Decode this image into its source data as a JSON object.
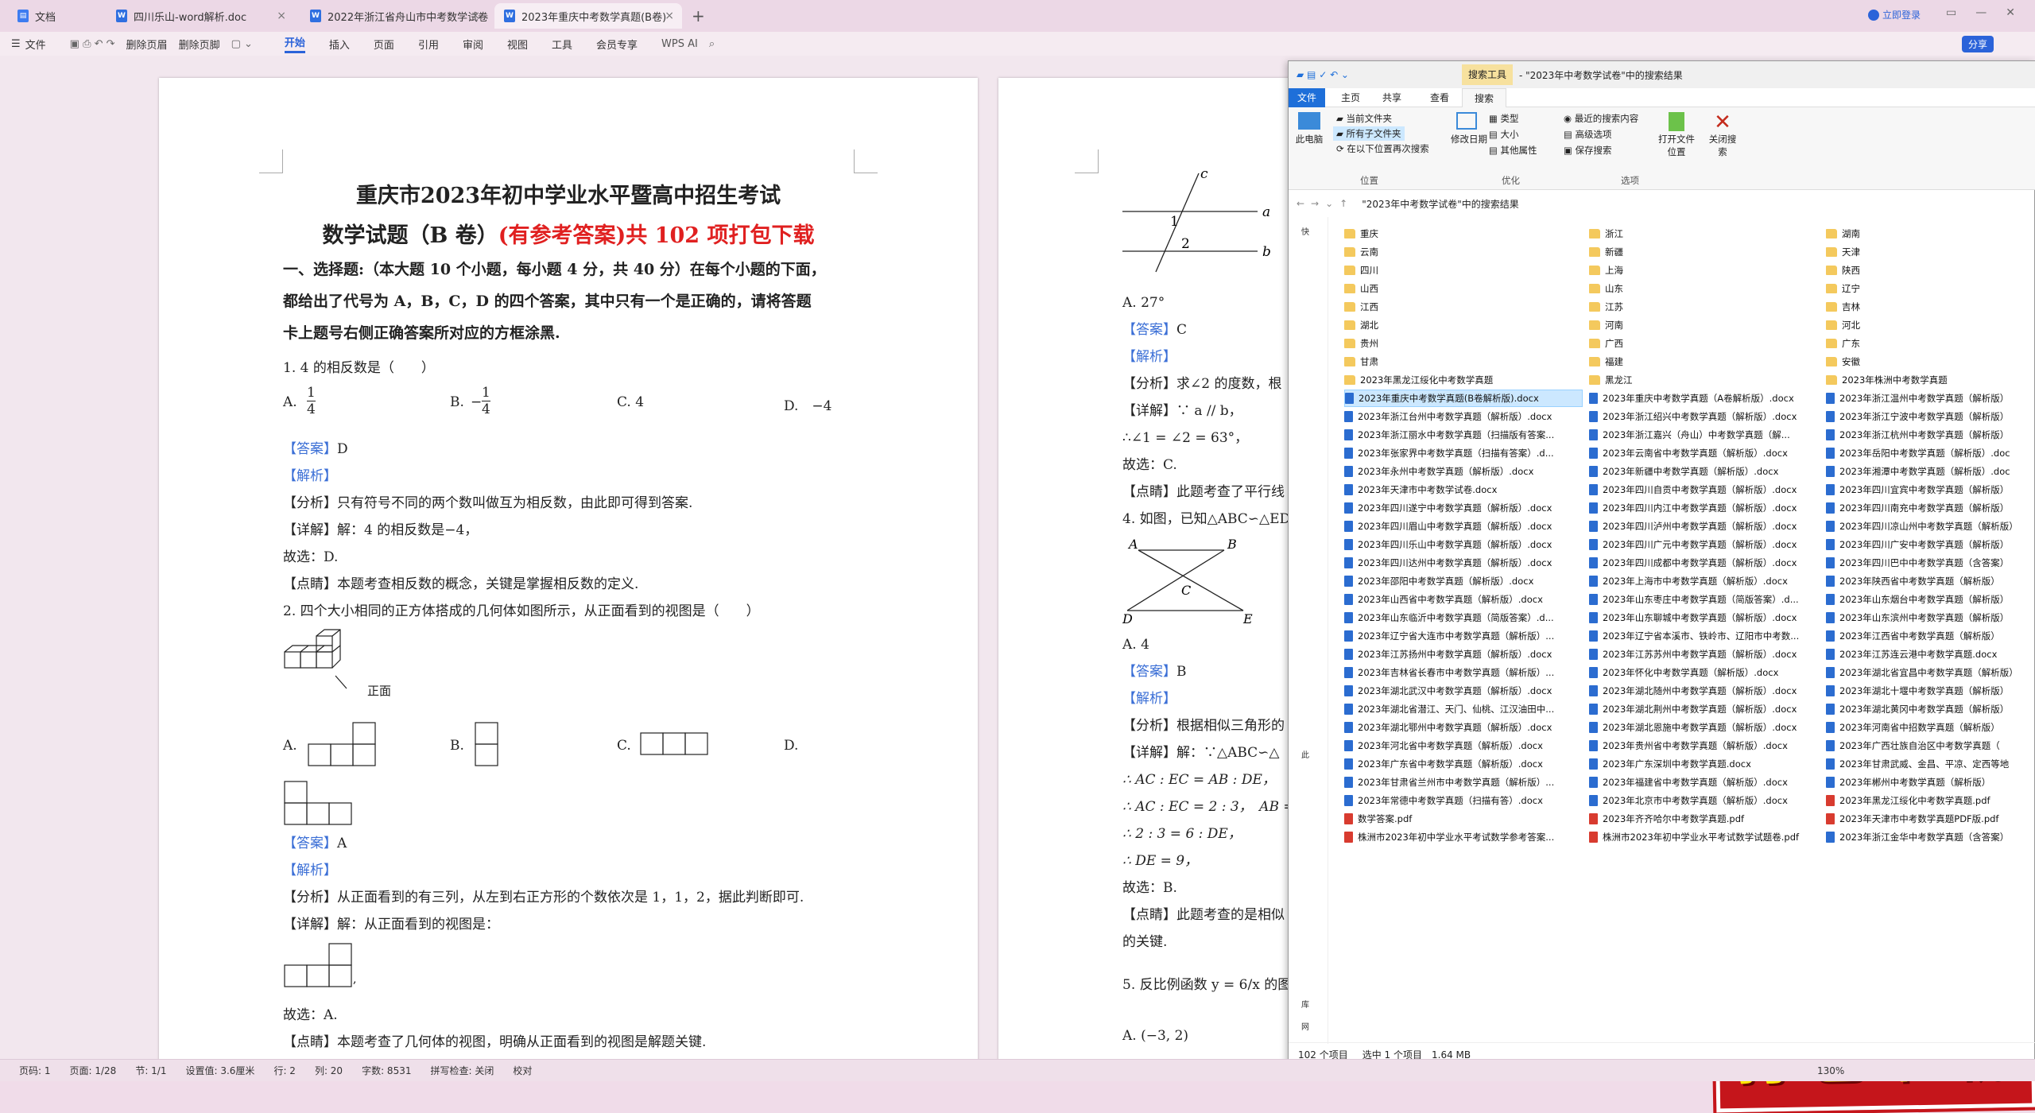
{
  "tabs": [
    {
      "label": "文档"
    },
    {
      "label": "四川乐山-word解析.doc"
    },
    {
      "label": "2022年浙江省舟山市中考数学试卷"
    },
    {
      "label": "2023年重庆中考数学真题(B卷)"
    }
  ],
  "window": {
    "login": "立即登录",
    "share": "分享"
  },
  "toolbar": {
    "file": "文件",
    "delete_header": "删除页眉",
    "delete_footer": "删除页脚",
    "start": "开始",
    "insert": "插入",
    "page": "页面",
    "reference": "引用",
    "review": "审阅",
    "view": "视图",
    "tools": "工具",
    "member": "会员专享",
    "wps_ai": "WPS AI"
  },
  "doc": {
    "title1": "重庆市2023年初中学业水平暨高中招生考试",
    "title2a": "数学试题（B 卷）",
    "title2b": "(有参考答案)共 102 项打包下载",
    "section1": "一、选择题:（本大题 10 个小题，每小题 4 分，共 40 分）在每个小题的下面，",
    "section2": "都给出了代号为 A，B，C，D 的四个答案，其中只有一个是正确的，请将答题",
    "section3": "卡上题号右侧正确答案所对应的方框涂黑.",
    "q1": "1. 4 的相反数是（　　）",
    "q1_opts": [
      "A.",
      "B.",
      "C. 4",
      "D.　−4"
    ],
    "q1_fracA": "1/4",
    "q1_fracB": "−1/4",
    "answer_label": "【答案】",
    "q1_answer": "D",
    "analysis_label": "【解析】",
    "q1_fenxi": "【分析】只有符号不同的两个数叫做互为相反数，由此即可得到答案.",
    "q1_xiangjie": "【详解】解：4 的相反数是−4，",
    "q1_gu": "故选：D.",
    "q1_dianjing": "【点睛】本题考查相反数的概念，关键是掌握相反数的定义.",
    "q2": "2. 四个大小相同的正方体搭成的几何体如图所示，从正面看到的视图是（　　）",
    "q2_front": "正面",
    "q2_opts": [
      "A.",
      "B.",
      "C.",
      "D."
    ],
    "q2_answer": "A",
    "q2_fenxi": "【分析】从正面看到的有三列，从左到右正方形的个数依次是 1，1，2，据此判断即可.",
    "q2_xiangjie": "【详解】解：从正面看到的视图是：",
    "q2_gu": "故选：A.",
    "q2_dianjing": "【点睛】本题考查了几何体的视图，明确从正面看到的视图是解题关键."
  },
  "doc2": {
    "a27": "A.  27°",
    "ans_c": "C",
    "fenxi": "【分析】求∠2 的度数，根",
    "xiangjie": "【详解】∵ a // b，",
    "eq": "∴∠1 = ∠2 = 63°，",
    "gu_c": "故选：C.",
    "dian": "【点睛】此题考查了平行线",
    "q4": "4. 如图，已知△ABC∽△ED",
    "labels": [
      "A",
      "B",
      "C",
      "D",
      "E",
      "a",
      "b",
      "c",
      "1",
      "2"
    ],
    "a4": "A. 4",
    "ans_b": "B",
    "fenxi2": "【分析】根据相似三角形的",
    "xiangjie2": "【详解】解：∵△ABC∽△",
    "e1": "∴ AC : EC = AB : DE，",
    "e2": "∴ AC : EC = 2 : 3，　AB =",
    "e3": "∴ 2 : 3 = 6 : DE，",
    "e4": "∴ DE = 9，",
    "gu_b": "故选：B.",
    "dian2": "【点睛】此题考查的是相似",
    "dian2b": "的关键.",
    "q5": "5. 反比例函数 y = 6/x 的图象",
    "a5": "A.  (−3, 2)"
  },
  "explorer": {
    "title": "- \"2023年中考数学试卷\"中的搜索结果",
    "search_tools": "搜索工具",
    "menu": [
      "文件",
      "主页",
      "共享",
      "查看",
      "搜索"
    ],
    "ribbon": {
      "this_pc": "此电脑",
      "current_folder": "当前文件夹",
      "all_subfolders": "所有子文件夹",
      "search_again": "在以下位置再次搜索",
      "location": "位置",
      "modified": "修改日期",
      "type": "类型",
      "size": "大小",
      "other_props": "其他属性",
      "refine": "优化",
      "recent": "最近的搜索内容",
      "advanced": "高级选项",
      "save_search": "保存搜索",
      "options": "选项",
      "open_location": "打开文件位置",
      "close_search": "关闭搜索"
    },
    "address": "\"2023年中考数学试卷\"中的搜索结果",
    "nav": [
      "快",
      "此",
      "库",
      "网"
    ],
    "status_count": "102 个项目",
    "status_sel": "选中 1 个项目　1.64 MB",
    "col1": [
      {
        "name": "重庆",
        "t": "folder"
      },
      {
        "name": "云南",
        "t": "folder"
      },
      {
        "name": "四川",
        "t": "folder"
      },
      {
        "name": "山西",
        "t": "folder"
      },
      {
        "name": "江西",
        "t": "folder"
      },
      {
        "name": "湖北",
        "t": "folder"
      },
      {
        "name": "贵州",
        "t": "folder"
      },
      {
        "name": "甘肃",
        "t": "folder"
      },
      {
        "name": "2023年黑龙江绥化中考数学真题",
        "t": "folder"
      },
      {
        "name": "2023年重庆中考数学真题(B卷解析版).docx",
        "t": "doc",
        "sel": true
      },
      {
        "name": "2023年浙江台州中考数学真题（解析版）.docx",
        "t": "doc"
      },
      {
        "name": "2023年浙江丽水中考数学真题（扫描版有答案...",
        "t": "doc"
      },
      {
        "name": "2023年张家界中考数学真题（扫描有答案）.d...",
        "t": "doc"
      },
      {
        "name": "2023年永州中考数学真题（解析版）.docx",
        "t": "doc"
      },
      {
        "name": "2023年天津市中考数学试卷.docx",
        "t": "doc"
      },
      {
        "name": "2023年四川遂宁中考数学真题（解析版）.docx",
        "t": "doc"
      },
      {
        "name": "2023年四川眉山中考数学真题（解析版）.docx",
        "t": "doc"
      },
      {
        "name": "2023年四川乐山中考数学真题（解析版）.docx",
        "t": "doc"
      },
      {
        "name": "2023年四川达州中考数学真题（解析版）.docx",
        "t": "doc"
      },
      {
        "name": "2023年邵阳中考数学真题（解析版）.docx",
        "t": "doc"
      },
      {
        "name": "2023年山西省中考数学真题（解析版）.docx",
        "t": "doc"
      },
      {
        "name": "2023年山东临沂中考数学真题（简版答案）.d...",
        "t": "doc"
      },
      {
        "name": "2023年辽宁省大连市中考数学真题（解析版）...",
        "t": "doc"
      },
      {
        "name": "2023年江苏扬州中考数学真题（解析版）.docx",
        "t": "doc"
      },
      {
        "name": "2023年吉林省长春市中考数学真题（解析版）...",
        "t": "doc"
      },
      {
        "name": "2023年湖北武汉中考数学真题（解析版）.docx",
        "t": "doc"
      },
      {
        "name": "2023年湖北省潜江、天门、仙桃、江汉油田中...",
        "t": "doc"
      },
      {
        "name": "2023年湖北鄂州中考数学真题（解析版）.docx",
        "t": "doc"
      },
      {
        "name": "2023年河北省中考数学真题（解析版）.docx",
        "t": "doc"
      },
      {
        "name": "2023年广东省中考数学真题（解析版）.docx",
        "t": "doc"
      },
      {
        "name": "2023年甘肃省兰州市中考数学真题（解析版）...",
        "t": "doc"
      },
      {
        "name": "2023年常德中考数学真题（扫描有答）.docx",
        "t": "doc"
      },
      {
        "name": "数学答案.pdf",
        "t": "pdf"
      },
      {
        "name": "株洲市2023年初中学业水平考试数学参考答案...",
        "t": "pdf"
      }
    ],
    "col2": [
      {
        "name": "浙江",
        "t": "folder"
      },
      {
        "name": "新疆",
        "t": "folder"
      },
      {
        "name": "上海",
        "t": "folder"
      },
      {
        "name": "山东",
        "t": "folder"
      },
      {
        "name": "江苏",
        "t": "folder"
      },
      {
        "name": "河南",
        "t": "folder"
      },
      {
        "name": "广西",
        "t": "folder"
      },
      {
        "name": "福建",
        "t": "folder"
      },
      {
        "name": "黑龙江",
        "t": "folder"
      },
      {
        "name": "2023年重庆中考数学真题（A卷解析版）.docx",
        "t": "doc"
      },
      {
        "name": "2023年浙江绍兴中考数学真题（解析版）.docx",
        "t": "doc"
      },
      {
        "name": "2023年浙江嘉兴（舟山）中考数学真题（解...",
        "t": "doc"
      },
      {
        "name": "2023年云南省中考数学真题（解析版）.docx",
        "t": "doc"
      },
      {
        "name": "2023年新疆中考数学真题（解析版）.docx",
        "t": "doc"
      },
      {
        "name": "2023年四川自贡中考数学真题（解析版）.docx",
        "t": "doc"
      },
      {
        "name": "2023年四川内江中考数学真题（解析版）.docx",
        "t": "doc"
      },
      {
        "name": "2023年四川泸州中考数学真题（解析版）.docx",
        "t": "doc"
      },
      {
        "name": "2023年四川广元中考数学真题（解析版）.docx",
        "t": "doc"
      },
      {
        "name": "2023年四川成都中考数学真题（解析版）.docx",
        "t": "doc"
      },
      {
        "name": "2023年上海市中考数学真题（解析版）.docx",
        "t": "doc"
      },
      {
        "name": "2023年山东枣庄中考数学真题（简版答案）.d...",
        "t": "doc"
      },
      {
        "name": "2023年山东聊城中考数学真题（解析版）.docx",
        "t": "doc"
      },
      {
        "name": "2023年辽宁省本溪市、铁岭市、辽阳市中考数...",
        "t": "doc"
      },
      {
        "name": "2023年江苏苏州中考数学真题（解析版）.docx",
        "t": "doc"
      },
      {
        "name": "2023年怀化中考数学真题（解析版）.docx",
        "t": "doc"
      },
      {
        "name": "2023年湖北随州中考数学真题（解析版）.docx",
        "t": "doc"
      },
      {
        "name": "2023年湖北荆州中考数学真题（解析版）.docx",
        "t": "doc"
      },
      {
        "name": "2023年湖北恩施中考数学真题（解析版）.docx",
        "t": "doc"
      },
      {
        "name": "2023年贵州省中考数学真题（解析版）.docx",
        "t": "doc"
      },
      {
        "name": "2023年广东深圳中考数学真题.docx",
        "t": "doc"
      },
      {
        "name": "2023年福建省中考数学真题（解析版）.docx",
        "t": "doc"
      },
      {
        "name": "2023年北京市中考数学真题（解析版）.docx",
        "t": "doc"
      },
      {
        "name": "2023年齐齐哈尔中考数学真题.pdf",
        "t": "pdf"
      },
      {
        "name": "株洲市2023年初中学业水平考试数学试题卷.pdf",
        "t": "pdf"
      }
    ],
    "col3": [
      {
        "name": "湖南",
        "t": "folder"
      },
      {
        "name": "天津",
        "t": "folder"
      },
      {
        "name": "陕西",
        "t": "folder"
      },
      {
        "name": "辽宁",
        "t": "folder"
      },
      {
        "name": "吉林",
        "t": "folder"
      },
      {
        "name": "河北",
        "t": "folder"
      },
      {
        "name": "广东",
        "t": "folder"
      },
      {
        "name": "安徽",
        "t": "folder"
      },
      {
        "name": "2023年株洲中考数学真题",
        "t": "folder"
      },
      {
        "name": "2023年浙江温州中考数学真题（解析版）",
        "t": "doc"
      },
      {
        "name": "2023年浙江宁波中考数学真题（解析版）",
        "t": "doc"
      },
      {
        "name": "2023年浙江杭州中考数学真题（解析版）",
        "t": "doc"
      },
      {
        "name": "2023年岳阳中考数学真题（解析版）.doc",
        "t": "doc"
      },
      {
        "name": "2023年湘潭中考数学真题（解析版）.doc",
        "t": "doc"
      },
      {
        "name": "2023年四川宜宾中考数学真题（解析版）",
        "t": "doc"
      },
      {
        "name": "2023年四川南充中考数学真题（解析版）",
        "t": "doc"
      },
      {
        "name": "2023年四川凉山州中考数学真题（解析版）",
        "t": "doc"
      },
      {
        "name": "2023年四川广安中考数学真题（解析版）",
        "t": "doc"
      },
      {
        "name": "2023年四川巴中中考数学真题（含答案）",
        "t": "doc"
      },
      {
        "name": "2023年陕西省中考数学真题（解析版）",
        "t": "doc"
      },
      {
        "name": "2023年山东烟台中考数学真题（解析版）",
        "t": "doc"
      },
      {
        "name": "2023年山东滨州中考数学真题（解析版）",
        "t": "doc"
      },
      {
        "name": "2023年江西省中考数学真题（解析版）",
        "t": "doc"
      },
      {
        "name": "2023年江苏连云港中考数学真题.docx",
        "t": "doc"
      },
      {
        "name": "2023年湖北省宜昌中考数学真题（解析版）",
        "t": "doc"
      },
      {
        "name": "2023年湖北十堰中考数学真题（解析版）",
        "t": "doc"
      },
      {
        "name": "2023年湖北黄冈中考数学真题（解析版）",
        "t": "doc"
      },
      {
        "name": "2023年河南省中招数学真题（解析版）",
        "t": "doc"
      },
      {
        "name": "2023年广西壮族自治区中考数学真题（",
        "t": "doc"
      },
      {
        "name": "2023年甘肃武威、金昌、平凉、定西等地",
        "t": "doc"
      },
      {
        "name": "2023年郴州中考数学真题（解析版）",
        "t": "doc"
      },
      {
        "name": "2023年黑龙江绥化中考数学真题.pdf",
        "t": "pdf"
      },
      {
        "name": "2023年天津市中考数学真题PDF版.pdf",
        "t": "pdf"
      },
      {
        "name": "2023年浙江金华中考数学真题（含答案）",
        "t": "doc"
      }
    ]
  },
  "stamp": "打包下载",
  "status": {
    "page": "页码: 1",
    "pages": "页面: 1/28",
    "section": "节: 1/1",
    "setting": "设置值: 3.6厘米",
    "row": "行: 2",
    "col": "列: 20",
    "words": "字数: 8531",
    "spell": "拼写检查: 关闭",
    "proof": "校对",
    "zoom": "130%"
  }
}
